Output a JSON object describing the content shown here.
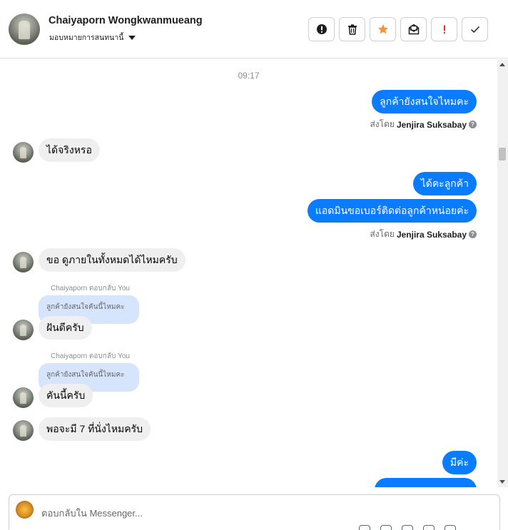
{
  "header": {
    "contact_name": "Chaiyaporn Wongkwanmueang",
    "assign_label": "มอบหมายการสนทนานี้"
  },
  "thread": {
    "timestamp": "09:17",
    "messages": [
      {
        "dir": "out",
        "text": "ลูกค้ายังสนใจไหมคะ"
      },
      {
        "dir": "in",
        "text": "ได้จริงหรอ"
      },
      {
        "dir": "out",
        "text": "ได้คะลูกค้า"
      },
      {
        "dir": "out",
        "text": "แอดมินขอเบอร์ติดต่อลูกค้าหน่อยค่ะ"
      },
      {
        "dir": "in",
        "text": "ขอ ดูภายในทั้งหมดได้ไหมครับ"
      },
      {
        "dir": "in",
        "text": "ฝันดีครับ",
        "reply_note": "Chaiyaporn ตอบกลับ You",
        "quoted": "ลูกค้ายังสนใจคันนี้ไหมคะ"
      },
      {
        "dir": "in",
        "text": "คันนี้ครับ",
        "reply_note": "Chaiyaporn ตอบกลับ You",
        "quoted": "ลูกค้ายังสนใจคันนี้ไหมคะ"
      },
      {
        "dir": "in",
        "text": "พอจะมี 7 ที่นั่งไหมครับ"
      },
      {
        "dir": "out",
        "text": "มีค่ะ"
      }
    ],
    "sent_by_prefix": "ส่งโดย",
    "sent_by_name": "Jenjira Suksabay"
  },
  "composer": {
    "placeholder": "ตอบกลับใน Messenger..."
  },
  "colors": {
    "outgoing_bubble": "#0a7cff",
    "incoming_bubble": "#efefef",
    "quoted_bubble": "#d6e4fc"
  }
}
